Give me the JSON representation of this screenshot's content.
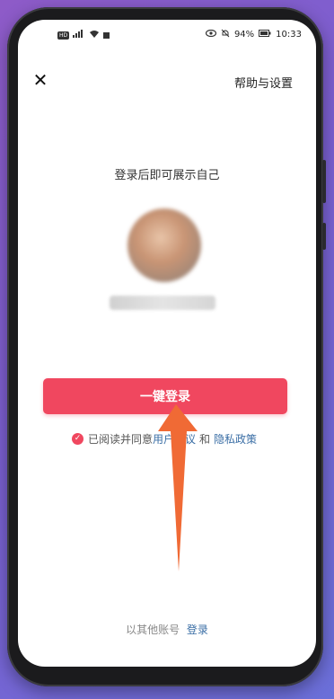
{
  "status_bar": {
    "left_chip": "HD",
    "battery": "94%",
    "time": "10:33"
  },
  "header": {
    "close_icon": "close-icon",
    "help_label": "帮助与设置"
  },
  "main": {
    "tagline": "登录后即可展示自己",
    "login_button_label": "一键登录",
    "agreement_prefix": "已阅读并同意",
    "agreement_link1": "用户协议",
    "agreement_and": "和",
    "agreement_link2": "隐私政策"
  },
  "footer": {
    "other_prefix": "以其他账号",
    "other_link": "登录"
  },
  "colors": {
    "accent": "#f0475f",
    "link": "#3a6ea5",
    "arrow": "#f06a35"
  }
}
